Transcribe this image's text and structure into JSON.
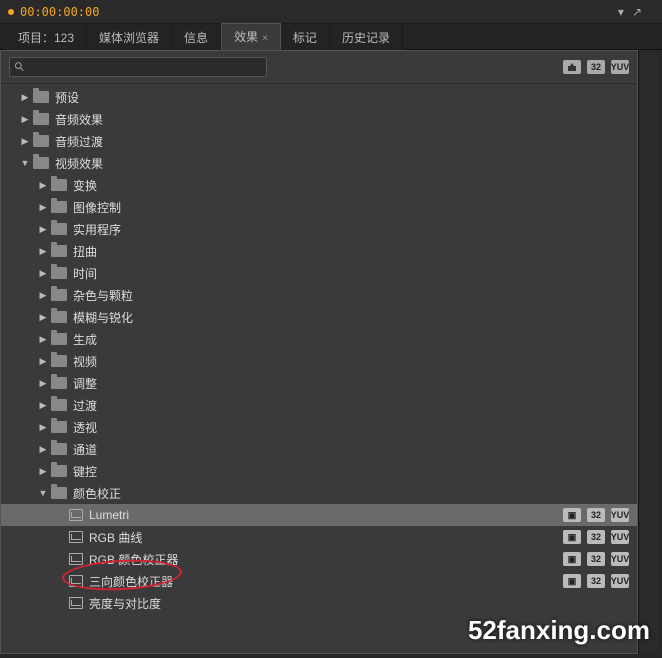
{
  "topbar": {
    "timecode": "00:00:00:00"
  },
  "tabs": {
    "project": "项目：123",
    "media": "媒体浏览器",
    "info": "信息",
    "effects": "效果",
    "markers": "标记",
    "history": "历史记录"
  },
  "search": {
    "placeholder": ""
  },
  "badges": {
    "b32": "32",
    "yuv": "YUV"
  },
  "tree": {
    "presets": "预设",
    "audio_fx": "音频效果",
    "audio_tr": "音频过渡",
    "video_fx": "视频效果",
    "transform": "变换",
    "image_ctrl": "图像控制",
    "utility": "实用程序",
    "distort": "扭曲",
    "time": "时间",
    "noise": "杂色与颗粒",
    "blur": "模糊与锐化",
    "generate": "生成",
    "video": "视频",
    "adjust": "调整",
    "transition": "过渡",
    "perspective": "透视",
    "channel": "通道",
    "keying": "键控",
    "color_corr": "颜色校正",
    "lumetri": "Lumetri",
    "rgb_curves": "RGB 曲线",
    "rgb_corrector": "RGB 颜色校正器",
    "three_way": "三向颜色校正器",
    "bright_contrast": "亮度与对比度"
  },
  "watermark": "52fanxing.com"
}
